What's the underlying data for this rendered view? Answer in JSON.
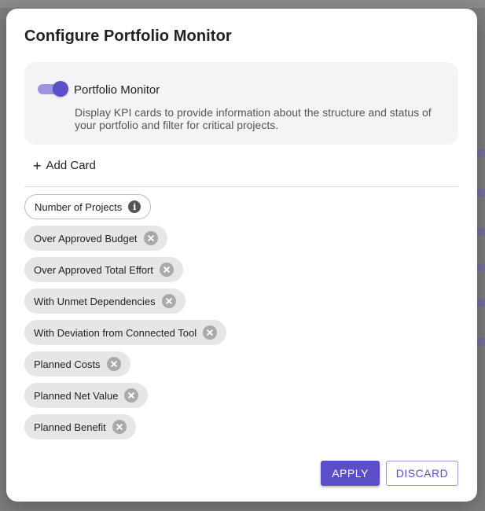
{
  "dialog": {
    "title": "Configure Portfolio Monitor",
    "monitor": {
      "label": "Portfolio Monitor",
      "enabled": true,
      "description": "Display KPI cards to provide information about the structure and status of your portfolio and filter for critical projects."
    },
    "add_card_label": "Add Card",
    "cards": [
      {
        "label": "Number of Projects",
        "removable": false,
        "icon": "info-icon"
      },
      {
        "label": "Over Approved Budget",
        "removable": true,
        "icon": "close-icon"
      },
      {
        "label": "Over Approved Total Effort",
        "removable": true,
        "icon": "close-icon"
      },
      {
        "label": "With Unmet Dependencies",
        "removable": true,
        "icon": "close-icon"
      },
      {
        "label": "With Deviation from Connected Tool",
        "removable": true,
        "icon": "close-icon"
      },
      {
        "label": "Planned Costs",
        "removable": true,
        "icon": "close-icon"
      },
      {
        "label": "Planned Net Value",
        "removable": true,
        "icon": "close-icon"
      },
      {
        "label": "Planned Benefit",
        "removable": true,
        "icon": "close-icon"
      }
    ],
    "buttons": {
      "apply": "APPLY",
      "discard": "DISCARD"
    }
  },
  "colors": {
    "accent": "#5b4fc7",
    "toggle_track": "#9b95e0",
    "chip_bg": "#e6e6e6",
    "overlay": "#7c7c7c"
  }
}
